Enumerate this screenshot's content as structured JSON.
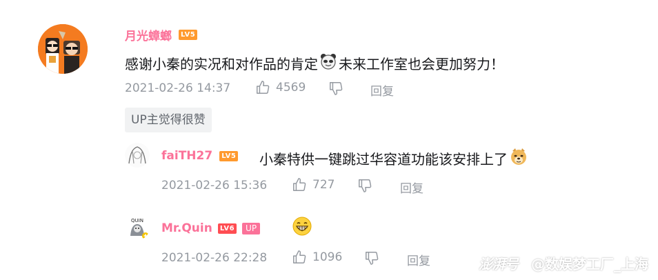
{
  "colors": {
    "username": "#fb7299",
    "meta": "#9499a0",
    "text": "#18191c",
    "lv5": "#ff9a2e",
    "lv6": "#ff4d52",
    "avatar_bg": "#f47b20"
  },
  "main_comment": {
    "username": "月光蟑螂",
    "level": "LV5",
    "text_before_emoji": "感谢小秦的实况和对作品的肯定",
    "emoji": "panda-emoji",
    "text_after_emoji": "未来工作室也会更加努力！",
    "timestamp": "2021-02-26 14:37",
    "likes": "4569",
    "reply_label": "回复",
    "up_liked_label": "UP主觉得很赞"
  },
  "replies": [
    {
      "username": "faiTH27",
      "level": "LV5",
      "text": "小秦特供一键跳过华容道功能该安排上了",
      "emoji": "doge-emoji",
      "timestamp": "2021-02-26 15:36",
      "likes": "727",
      "reply_label": "回复"
    },
    {
      "username": "Mr.Quin",
      "level": "LV6",
      "up_badge": "UP",
      "avatar_text": "QUIN",
      "emoji": "grin-emoji",
      "timestamp": "2021-02-26 22:28",
      "likes": "1096",
      "reply_label": "回复"
    }
  ],
  "watermark": {
    "logo": "澎湃号",
    "account": "@数娱梦工厂_上海"
  }
}
